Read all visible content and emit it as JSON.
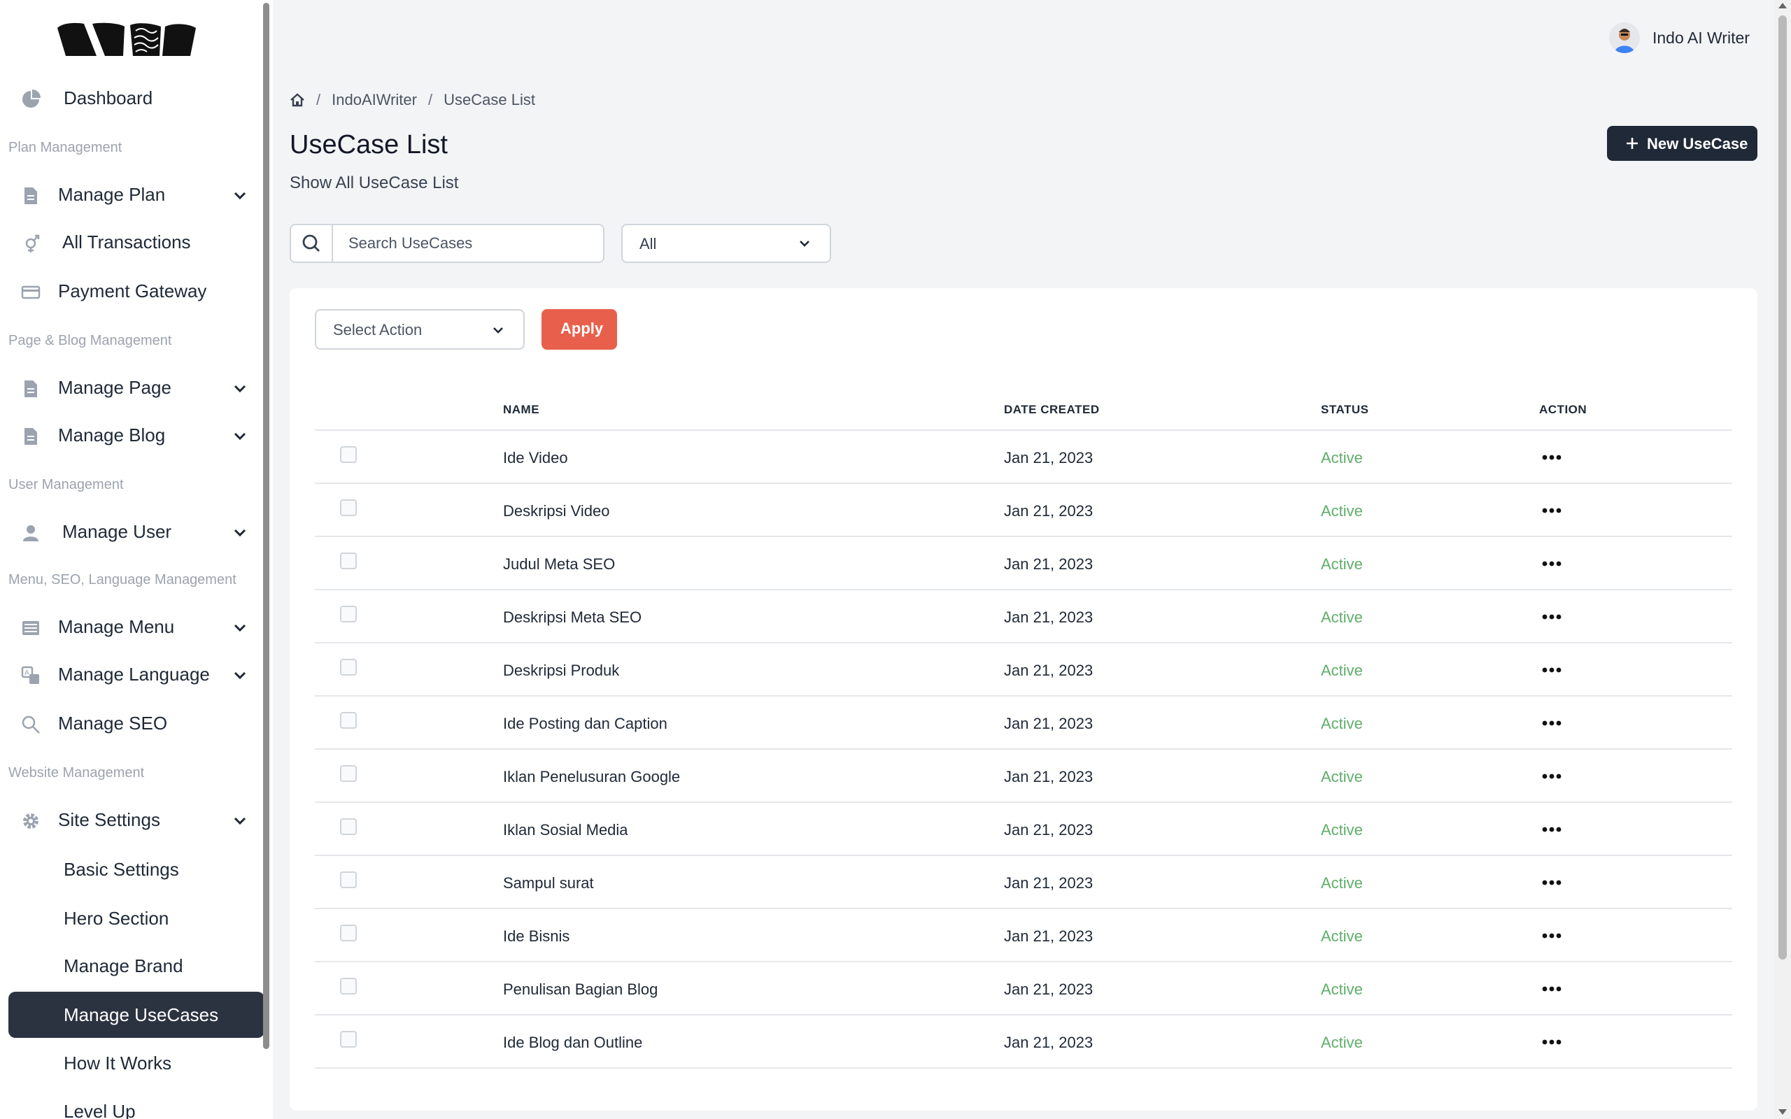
{
  "sidebar": {
    "items": [
      {
        "label": "Dashboard",
        "icon": "pie-chart-icon"
      },
      {
        "heading": "Plan Management"
      },
      {
        "label": "Manage Plan",
        "icon": "document-icon"
      },
      {
        "label": "All Transactions",
        "icon": "transactions-icon"
      },
      {
        "label": "Payment Gateway",
        "icon": "credit-card-icon"
      },
      {
        "heading": "Page & Blog Management"
      },
      {
        "label": "Manage Page",
        "icon": "document-icon"
      },
      {
        "label": "Manage Blog",
        "icon": "document-icon"
      },
      {
        "heading": "User Management"
      },
      {
        "label": "Manage User",
        "icon": "user-icon"
      },
      {
        "heading": "Menu, SEO, Language Management"
      },
      {
        "label": "Manage Menu",
        "icon": "menu-icon"
      },
      {
        "label": "Manage Language",
        "icon": "language-icon"
      },
      {
        "label": "Manage SEO",
        "icon": "search-icon"
      },
      {
        "heading": "Website Management"
      },
      {
        "label": "Site Settings",
        "icon": "gear-icon"
      },
      {
        "label": "Basic Settings"
      },
      {
        "label": "Hero Section"
      },
      {
        "label": "Manage Brand"
      },
      {
        "label": "Manage UseCases",
        "active": true
      },
      {
        "label": "How It Works"
      },
      {
        "label": "Level Up"
      }
    ]
  },
  "header": {
    "user_name": "Indo AI Writer"
  },
  "breadcrumb": {
    "home_icon": "home-icon",
    "items": [
      "IndoAIWriter",
      "UseCase List"
    ],
    "separator": "/"
  },
  "page": {
    "title": "UseCase List",
    "subtitle": "Show All UseCase List",
    "new_button": "New UseCase"
  },
  "filters": {
    "search_placeholder": "Search UseCases",
    "status_value": "All"
  },
  "bulk": {
    "select_label": "Select Action",
    "apply_label": "Apply"
  },
  "table": {
    "columns": [
      "NAME",
      "DATE CREATED",
      "STATUS",
      "ACTION"
    ],
    "rows": [
      {
        "name": "Ide Video",
        "date": "Jan 21, 2023",
        "status": "Active"
      },
      {
        "name": "Deskripsi Video",
        "date": "Jan 21, 2023",
        "status": "Active"
      },
      {
        "name": "Judul Meta SEO",
        "date": "Jan 21, 2023",
        "status": "Active"
      },
      {
        "name": "Deskripsi Meta SEO",
        "date": "Jan 21, 2023",
        "status": "Active"
      },
      {
        "name": "Deskripsi Produk",
        "date": "Jan 21, 2023",
        "status": "Active"
      },
      {
        "name": "Ide Posting dan Caption",
        "date": "Jan 21, 2023",
        "status": "Active"
      },
      {
        "name": "Iklan Penelusuran Google",
        "date": "Jan 21, 2023",
        "status": "Active"
      },
      {
        "name": "Iklan Sosial Media",
        "date": "Jan 21, 2023",
        "status": "Active"
      },
      {
        "name": "Sampul surat",
        "date": "Jan 21, 2023",
        "status": "Active"
      },
      {
        "name": "Ide Bisnis",
        "date": "Jan 21, 2023",
        "status": "Active"
      },
      {
        "name": "Penulisan Bagian Blog",
        "date": "Jan 21, 2023",
        "status": "Active"
      },
      {
        "name": "Ide Blog dan Outline",
        "date": "Jan 21, 2023",
        "status": "Active"
      }
    ]
  },
  "colors": {
    "accent_dark": "#1f2937",
    "apply": "#e8604c",
    "active_status": "#5fae6a",
    "sidebar_active": "#2c3340"
  }
}
